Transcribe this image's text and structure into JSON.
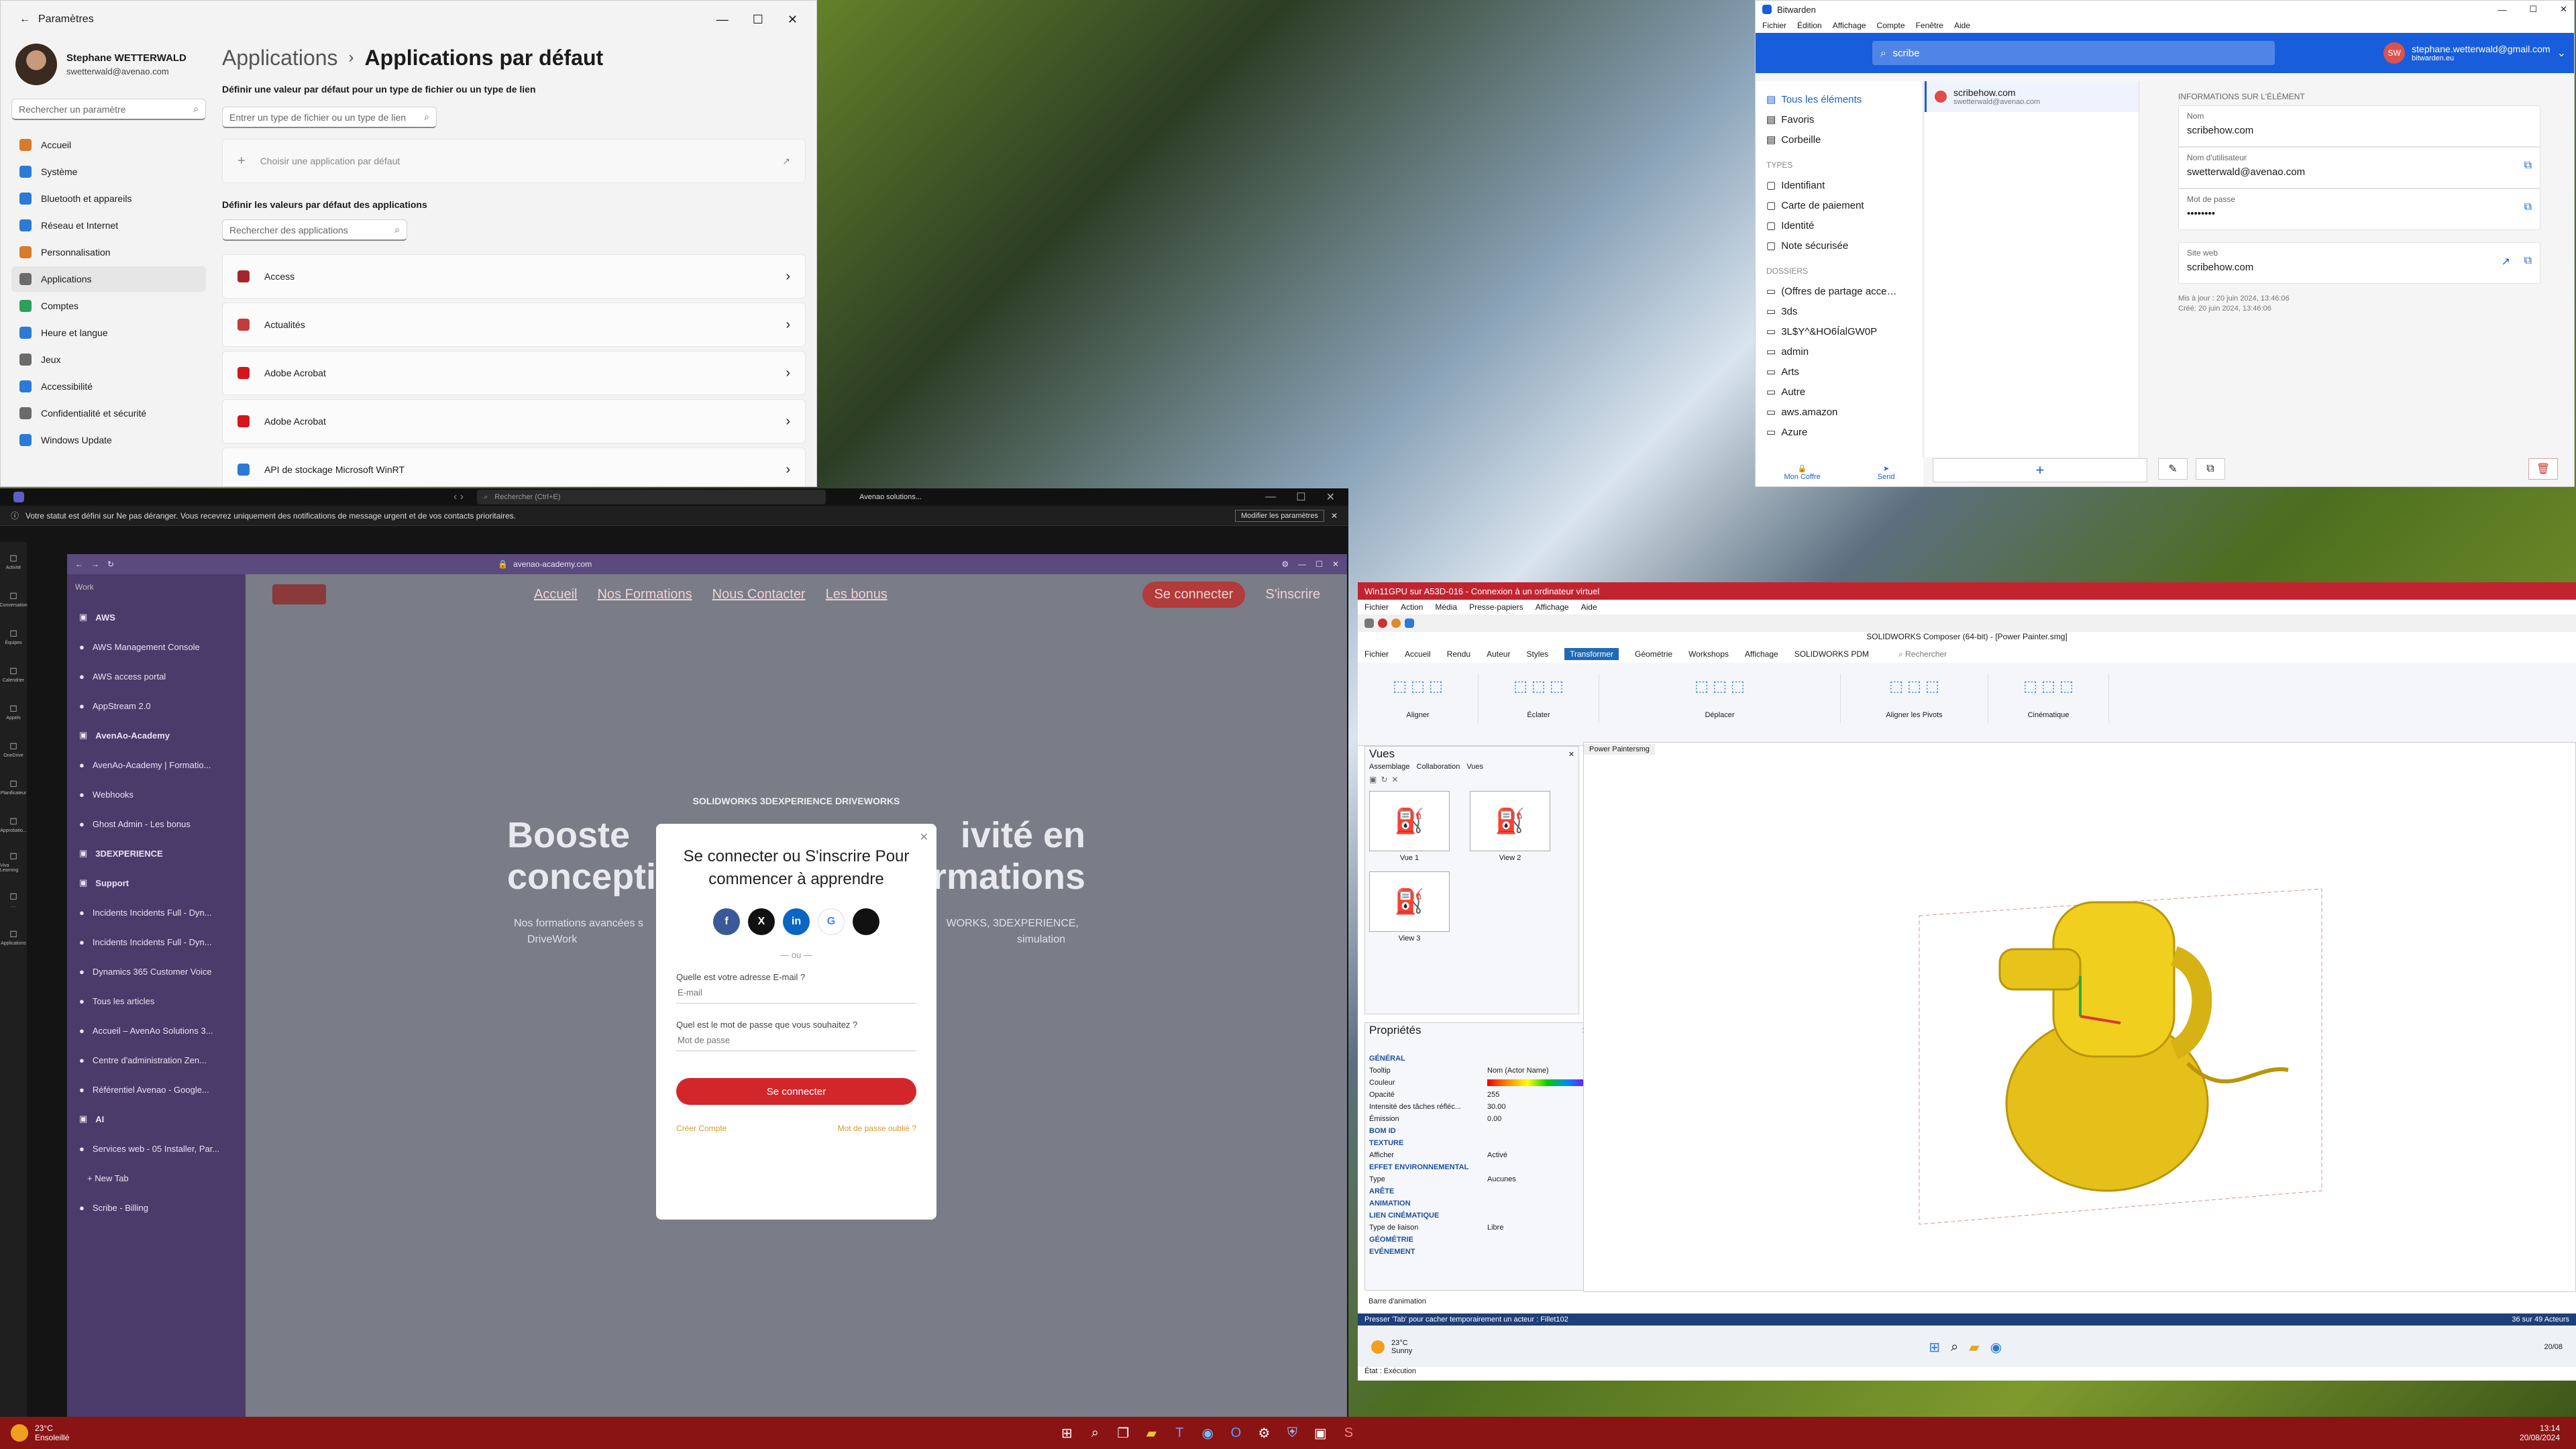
{
  "settings": {
    "window_title": "Paramètres",
    "user_name": "Stephane WETTERWALD",
    "user_email": "swetterwald@avenao.com",
    "search_placeholder": "Rechercher un paramètre",
    "nav": [
      {
        "label": "Accueil",
        "color": "#d87b2a"
      },
      {
        "label": "Système",
        "color": "#2b7bd6"
      },
      {
        "label": "Bluetooth et appareils",
        "color": "#2b7bd6"
      },
      {
        "label": "Réseau et Internet",
        "color": "#2b7bd6"
      },
      {
        "label": "Personnalisation",
        "color": "#d87b2a"
      },
      {
        "label": "Applications",
        "color": "#6b6b6b"
      },
      {
        "label": "Comptes",
        "color": "#2ba05a"
      },
      {
        "label": "Heure et langue",
        "color": "#2b7bd6"
      },
      {
        "label": "Jeux",
        "color": "#6b6b6b"
      },
      {
        "label": "Accessibilité",
        "color": "#2b7bd6"
      },
      {
        "label": "Confidentialité et sécurité",
        "color": "#6b6b6b"
      },
      {
        "label": "Windows Update",
        "color": "#2b7bd6"
      }
    ],
    "breadcrumb_parent": "Applications",
    "breadcrumb_current": "Applications par défaut",
    "section1": "Définir une valeur par défaut pour un type de fichier ou un type de lien",
    "filetype_placeholder": "Entrer un type de fichier ou un type de lien",
    "choose_default": "Choisir une application par défaut",
    "section2": "Définir les valeurs par défaut des applications",
    "app_search_placeholder": "Rechercher des applications",
    "apps": [
      {
        "label": "Access",
        "color": "#a4262c"
      },
      {
        "label": "Actualités",
        "color": "#c43b3b"
      },
      {
        "label": "Adobe Acrobat",
        "color": "#d4161b"
      },
      {
        "label": "Adobe Acrobat",
        "color": "#d4161b"
      },
      {
        "label": "API de stockage Microsoft WinRT",
        "color": "#2b7bd6"
      }
    ]
  },
  "bitwarden": {
    "window_title": "Bitwarden",
    "menu": [
      "Fichier",
      "Édition",
      "Affichage",
      "Compte",
      "Fenêtre",
      "Aide"
    ],
    "search_value": "scribe",
    "account_email": "stephane.wetterwald@gmail.com",
    "account_server": "bitwarden.eu",
    "avatar_initials": "SW",
    "nav_main": [
      "Tous les éléments",
      "Favoris",
      "Corbeille"
    ],
    "types_header": "TYPES",
    "types": [
      "Identifiant",
      "Carte de paiement",
      "Identité",
      "Note sécurisée"
    ],
    "folders_header": "DOSSIERS",
    "folders": [
      "(Offres de partage acce…",
      "3ds",
      "3L$Y^&HO6ÍalGW0P",
      "admin",
      "Arts",
      "Autre",
      "aws.amazon",
      "Azure"
    ],
    "bottom_tabs": [
      "Mon Coffre",
      "Send"
    ],
    "item_name": "scribehow.com",
    "item_user": "swetterwald@avenao.com",
    "detail_header": "INFORMATIONS SUR L'ÉLÉMENT",
    "fields": [
      {
        "label": "Nom",
        "value": "scribehow.com"
      },
      {
        "label": "Nom d'utilisateur",
        "value": "swetterwald@avenao.com"
      },
      {
        "label": "Mot de passe",
        "value": "••••••••"
      }
    ],
    "site_label": "Site web",
    "site_value": "scribehow.com",
    "updated": "Mis à jour : 20 juin 2024, 13:46:06",
    "created": "Créé: 20 juin 2024, 13:46:06"
  },
  "teams": {
    "search_placeholder": "Rechercher (Ctrl+E)",
    "org": "Avenao solutions...",
    "banner": "Votre statut est défini sur Ne pas déranger. Vous recevrez uniquement des notifications de message urgent et de vos contacts prioritaires.",
    "banner_button": "Modifier les paramètres",
    "rail": [
      "Activité",
      "Conversation",
      "Équipes",
      "Calendrier",
      "Appels",
      "OneDrive",
      "Planificateur",
      "Approbatio...",
      "Viva Learning",
      "…",
      "Applications"
    ]
  },
  "browser": {
    "url": "avenao-academy.com",
    "sidebar_workspace": "Work",
    "sidebar_items": [
      {
        "label": "AWS",
        "kind": "folder"
      },
      {
        "label": "AWS Management Console",
        "kind": "tab"
      },
      {
        "label": "AWS access portal",
        "kind": "tab"
      },
      {
        "label": "AppStream 2.0",
        "kind": "tab"
      },
      {
        "label": "AvenAo-Academy",
        "kind": "folder"
      },
      {
        "label": "AvenAo-Academy | Formatio...",
        "kind": "tab"
      },
      {
        "label": "Webhooks",
        "kind": "tab"
      },
      {
        "label": "Ghost Admin - Les bonus",
        "kind": "tab"
      },
      {
        "label": "3DEXPERIENCE",
        "kind": "folder"
      },
      {
        "label": "Support",
        "kind": "folder"
      },
      {
        "label": "Incidents Incidents Full - Dyn...",
        "kind": "tab"
      },
      {
        "label": "Incidents Incidents Full - Dyn...",
        "kind": "tab"
      },
      {
        "label": "Dynamics 365 Customer Voice",
        "kind": "tab"
      },
      {
        "label": "Tous les articles",
        "kind": "tab"
      },
      {
        "label": "Accueil – AvenAo Solutions 3...",
        "kind": "tab"
      },
      {
        "label": "Centre d'administration Zen...",
        "kind": "tab"
      },
      {
        "label": "Référentiel Avenao - Google...",
        "kind": "tab"
      },
      {
        "label": "AI",
        "kind": "folder"
      },
      {
        "label": "Services web - 05 Installer, Par...",
        "kind": "tab"
      },
      {
        "label": "+ New Tab",
        "kind": "new"
      },
      {
        "label": "Scribe - Billing",
        "kind": "tab"
      }
    ],
    "site_nav": [
      "Accueil",
      "Nos Formations",
      "Nous Contacter",
      "Les bonus"
    ],
    "site_btn_login": "Se connecter",
    "site_btn_signup": "S'inscrire",
    "hero_small": "SOLIDWORKS 3DEXPERIENCE DRIVEWORKS",
    "hero_left": "Booste",
    "hero_right": "ivité en",
    "hero_line2_left": "concepti",
    "hero_line2_right": "formations",
    "hero_sub_left": "Nos formations avancées s",
    "hero_sub_right": "WORKS, 3DEXPERIENCE,",
    "hero_sub2_left": "DriveWork",
    "hero_sub2_right": "simulation"
  },
  "modal": {
    "title": "Se connecter ou S'inscrire Pour commencer à apprendre",
    "or": "— ou —",
    "email_label": "Quelle est votre adresse E-mail ?",
    "email_placeholder": "E-mail",
    "password_label": "Quel est le mot de passe que vous souhaitez ?",
    "password_placeholder": "Mot de passe",
    "submit": "Se connecter",
    "create": "Créer Compte",
    "forgot": "Mot de passe oublié ?",
    "socials": [
      {
        "icon": "facebook-icon",
        "glyph": "f",
        "color": "#3b5998"
      },
      {
        "icon": "x-icon",
        "glyph": "X",
        "color": "#111111"
      },
      {
        "icon": "linkedin-icon",
        "glyph": "in",
        "color": "#0a66c2"
      },
      {
        "icon": "google-icon",
        "glyph": "G",
        "color": "#ffffff"
      },
      {
        "icon": "apple-icon",
        "glyph": "",
        "color": "#111111"
      }
    ]
  },
  "solidworks": {
    "rdp_title": "Win11GPU sur A53D-016 - Connexion à un ordinateur virtuel",
    "rdp_menu": [
      "Fichier",
      "Action",
      "Média",
      "Presse-papiers",
      "Affichage",
      "Aide"
    ],
    "app_title": "SOLIDWORKS Composer (64-bit) - [Power Painter.smg]",
    "tabs": [
      "Fichier",
      "Accueil",
      "Rendu",
      "Auteur",
      "Styles",
      "Transformer",
      "Géométrie",
      "Workshops",
      "Affichage",
      "SOLIDWORKS PDM"
    ],
    "search": "Rechercher",
    "groups": [
      "Aligner",
      "Éclater",
      "Déplacer",
      "Aligner les Pivots",
      "Cinématique"
    ],
    "views_title": "Vues",
    "views_tabs": [
      "Assemblage",
      "Collaboration",
      "Vues"
    ],
    "views": [
      "Vue 1",
      "View 2",
      "View 3"
    ],
    "viewport_tab": "Power Paintersmg",
    "props_title": "Propriétés",
    "props": [
      {
        "k": "GÉNÉRAL",
        "v": ""
      },
      {
        "k": "Tooltip",
        "v": "Nom (Actor Name)"
      },
      {
        "k": "Couleur",
        "v": ""
      },
      {
        "k": "Opacité",
        "v": "255"
      },
      {
        "k": "Intensité des tâches réfléc...",
        "v": "30.00"
      },
      {
        "k": "Émission",
        "v": "0.00"
      },
      {
        "k": "BOM ID",
        "v": ""
      },
      {
        "k": "TEXTURE",
        "v": ""
      },
      {
        "k": "Afficher",
        "v": "Activé"
      },
      {
        "k": "EFFET ENVIRONNEMENTAL",
        "v": ""
      },
      {
        "k": "Type",
        "v": "Aucunes"
      },
      {
        "k": "ARÊTE",
        "v": ""
      },
      {
        "k": "ANIMATION",
        "v": ""
      },
      {
        "k": "LIEN CINÉMATIQUE",
        "v": ""
      },
      {
        "k": "Type de liaison",
        "v": "Libre"
      },
      {
        "k": "GÉOMÉTRIE",
        "v": ""
      },
      {
        "k": "EVÉNEMENT",
        "v": ""
      }
    ],
    "anim_bar": "Barre d'animation",
    "status_left": "Presser 'Tab' pour cacher temporairement un acteur : Fillet102",
    "status_right": "36 sur 49 Acteurs",
    "weather_temp": "23°C",
    "weather_desc": "Sunny",
    "state": "État : Exécution",
    "inner_date": "20/08"
  },
  "taskbar": {
    "weather_temp": "23°C",
    "weather_desc": "Ensoleillé",
    "time": "13:14",
    "date": "20/08/2024"
  }
}
